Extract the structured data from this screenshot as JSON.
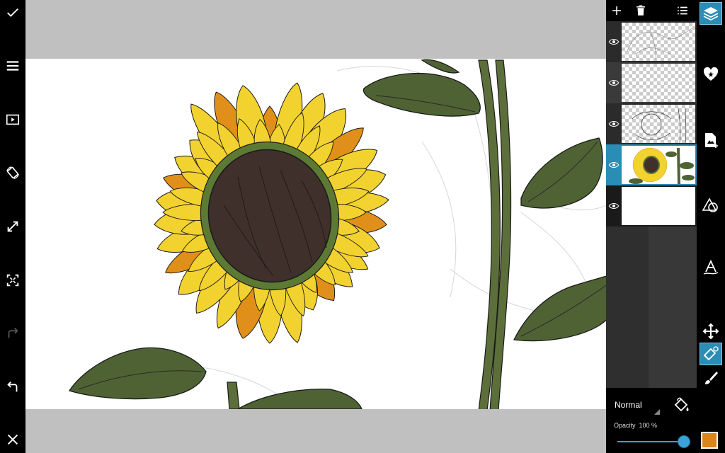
{
  "left_toolbar": {
    "icons": [
      "check-icon",
      "menu-icon",
      "play-icon",
      "rotate-icon",
      "resize-icon",
      "fit-screen-icon",
      "redo-icon",
      "undo-icon",
      "close-icon"
    ]
  },
  "layers": {
    "header_icons": [
      "add-icon",
      "trash-icon",
      "list-icon"
    ],
    "items": [
      {
        "name": "sketch-lines",
        "visible": true,
        "selected": false
      },
      {
        "name": "empty",
        "visible": true,
        "selected": false
      },
      {
        "name": "line-art",
        "visible": true,
        "selected": false
      },
      {
        "name": "sunflower-color",
        "visible": true,
        "selected": true
      },
      {
        "name": "white-background",
        "visible": true,
        "selected": false
      }
    ]
  },
  "blend": {
    "mode": "Normal",
    "opacity_label": "Opacity",
    "opacity_value": "100 %",
    "opacity": 1.0
  },
  "right_toolbar": {
    "icons": [
      "layers-icon",
      "heart-star-icon",
      "add-image-icon",
      "shapes-icon",
      "text-icon",
      "move-icon",
      "eraser-icon",
      "brush-icon"
    ],
    "selected": [
      "layers-icon",
      "eraser-icon"
    ]
  },
  "colors": {
    "current_color": "#d9841c",
    "accent": "#2a8db5",
    "petal": "#f2d22e",
    "petal_shadow": "#e0901a",
    "leaf": "#4f6234",
    "center": "#3f302b"
  }
}
